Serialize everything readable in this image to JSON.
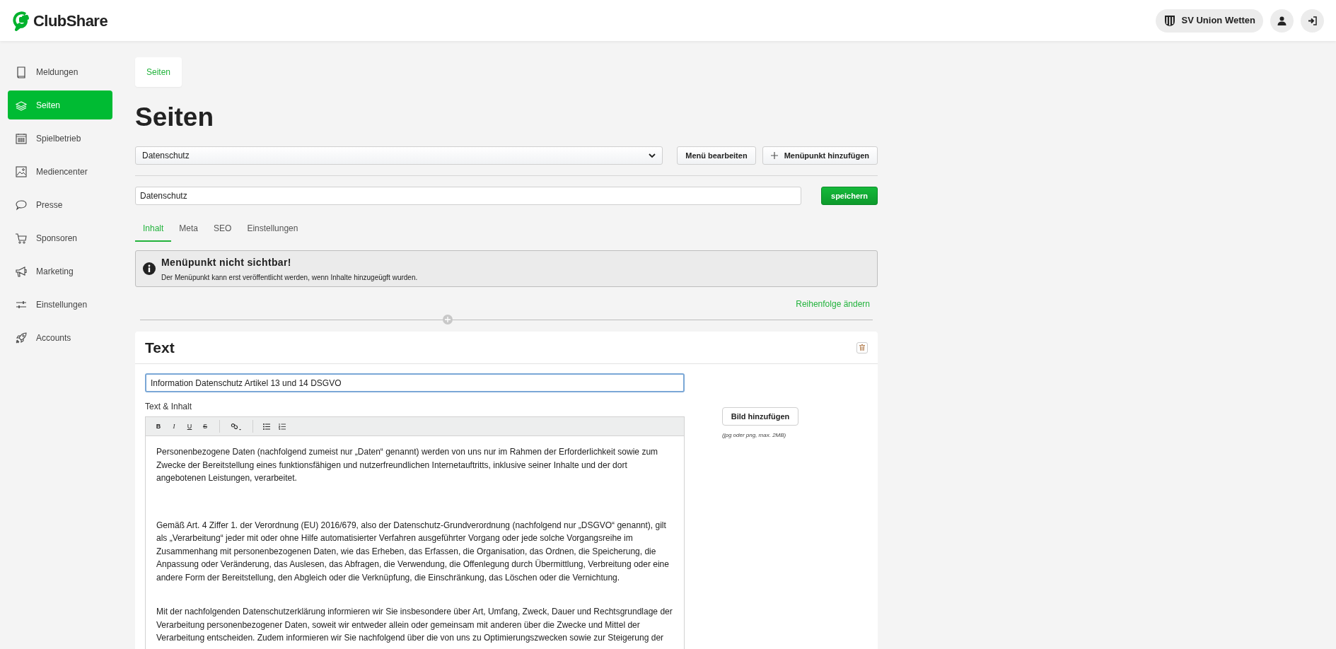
{
  "header": {
    "logo_text": "ClubShare",
    "club_name": "SV Union Wetten"
  },
  "sidebar": {
    "items": [
      {
        "label": "Meldungen",
        "selected": false
      },
      {
        "label": "Seiten",
        "selected": true
      },
      {
        "label": "Spielbetrieb",
        "selected": false
      },
      {
        "label": "Mediencenter",
        "selected": false
      },
      {
        "label": "Presse",
        "selected": false
      },
      {
        "label": "Sponsoren",
        "selected": false
      },
      {
        "label": "Marketing",
        "selected": false
      },
      {
        "label": "Einstellungen",
        "selected": false
      },
      {
        "label": "Accounts",
        "selected": false
      }
    ]
  },
  "breadcrumb": "Seiten",
  "page_title": "Seiten",
  "page_select": {
    "value": "Datenschutz"
  },
  "buttons": [
    "Menü bearbeiten",
    "Menüpunkt hinzufügen"
  ],
  "title_field": {
    "value": "Datenschutz"
  },
  "save_button": "speichern",
  "tabs": [
    {
      "label": "Inhalt",
      "selected": true
    },
    {
      "label": "Meta",
      "selected": false
    },
    {
      "label": "SEO",
      "selected": false
    },
    {
      "label": "Einstellungen",
      "selected": false
    }
  ],
  "alert": {
    "title": "Menüpunkt nicht sichtbar!",
    "message": "Der Menüpunkt kann erst veröffentlicht werden, wenn Inhalte hinzugeügft wurden."
  },
  "reorder_link": "Reihenfolge ändern",
  "block": {
    "title": "Text",
    "heading_field": {
      "value": "Information Datenschutz Artikel 13 und 14 DSGVO"
    },
    "editor_label": "Text & Inhalt",
    "toolbar": [
      {
        "kind": "bold",
        "label": "B"
      },
      {
        "kind": "italic",
        "label": "I"
      },
      {
        "kind": "underline",
        "label": "U"
      },
      {
        "kind": "strike",
        "label": "S"
      },
      {
        "kind": "link"
      },
      {
        "kind": "bullets"
      },
      {
        "kind": "numbers"
      }
    ],
    "paragraphs": [
      "Personenbezogene Daten (nachfolgend zumeist nur „Daten“ genannt) werden von uns nur im Rahmen der Erforderlichkeit sowie zum Zwecke der Bereitstellung eines funktionsfähigen und nutzerfreundlichen Internetauftritts, inklusive seiner Inhalte und der dort angebotenen Leistungen, verarbeitet.",
      "Gemäß Art. 4 Ziffer 1. der Verordnung (EU) 2016/679, also der Datenschutz-Grundverordnung (nachfolgend nur „DSGVO“ genannt), gilt als „Verarbeitung“ jeder mit oder ohne Hilfe automatisierter Verfahren ausgeführter Vorgang oder jede solche Vorgangsreihe im Zusammenhang mit personenbezogenen Daten, wie das Erheben, das Erfassen, die Organisation, das Ordnen, die Speicherung, die Anpassung oder Veränderung, das Auslesen, das Abfragen, die Verwendung, die Offenlegung durch Übermittlung, Verbreitung oder eine andere Form der Bereitstellung, den Abgleich oder die Verknüpfung, die Einschränkung, das Löschen oder die Vernichtung.",
      "Mit der nachfolgenden Datenschutzerklärung informieren wir Sie insbesondere über Art, Umfang, Zweck, Dauer und Rechtsgrundlage der Verarbeitung personenbezogener Daten, soweit wir entweder allein oder gemeinsam mit anderen über die Zwecke und Mittel der Verarbeitung entscheiden. Zudem informieren wir Sie nachfolgend über die von uns zu Optimierungszwecken sowie zur Steigerung der"
    ],
    "image_button": "Bild hinzufügen",
    "image_hint": "(jpg oder png, max. 2MB)"
  }
}
